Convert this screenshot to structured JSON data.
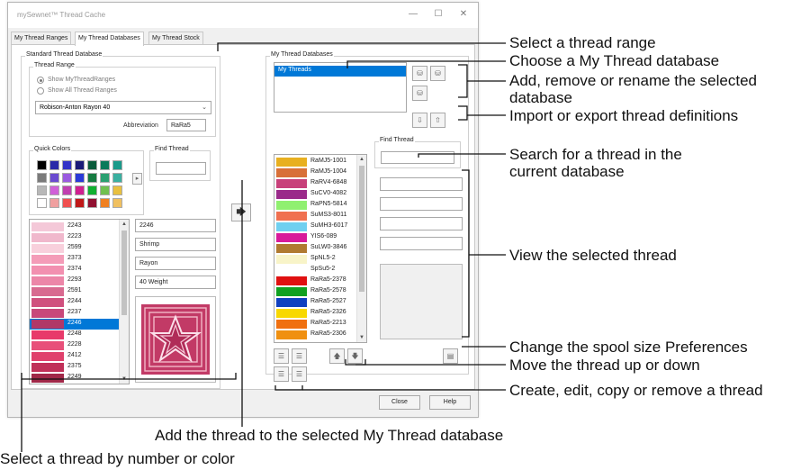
{
  "window": {
    "title": "mySewnet™ Thread Cache",
    "tabs": [
      "My Thread Ranges",
      "My Thread Databases",
      "My Thread Stock"
    ],
    "active_tab": 1
  },
  "standard_db": {
    "group_label": "Standard Thread Database",
    "thread_range_label": "Thread Range",
    "radio_show_my": "Show MyThreadRanges",
    "radio_show_all": "Show All Thread Ranges",
    "range_selected": "Robison-Anton Rayon 40",
    "abbreviation_label": "Abbreviation",
    "abbreviation_value": "RaRa5",
    "quick_colors_label": "Quick Colors",
    "find_thread_label": "Find Thread",
    "find_thread_value": "",
    "quick_colors": [
      [
        "#000000",
        "#2a2aa8",
        "#3434c8",
        "#1a1a78",
        "#0a5a3a",
        "#0a7a5a",
        "#1a9a8a"
      ],
      [
        "#7a7a7a",
        "#6a4ad0",
        "#9a5ae0",
        "#2a3ad8",
        "#157a40",
        "#2aa070",
        "#3ab0a0"
      ],
      [
        "#b8b8b8",
        "#d060d8",
        "#c040b0",
        "#d02090",
        "#10b030",
        "#70c050",
        "#e8c040"
      ],
      [
        "#ffffff",
        "#f0a0a0",
        "#f05050",
        "#c01818",
        "#901030",
        "#f08020",
        "#f0c060"
      ]
    ],
    "threads": [
      {
        "num": "2243",
        "color": "#f4c8d8"
      },
      {
        "num": "2223",
        "color": "#f0b8cc"
      },
      {
        "num": "2599",
        "color": "#f8d0dc"
      },
      {
        "num": "2373",
        "color": "#f49cb8"
      },
      {
        "num": "2374",
        "color": "#f290b0"
      },
      {
        "num": "2293",
        "color": "#ec86a8"
      },
      {
        "num": "2591",
        "color": "#d86a90"
      },
      {
        "num": "2244",
        "color": "#d0507e"
      },
      {
        "num": "2237",
        "color": "#c8487a"
      },
      {
        "num": "2246",
        "color": "#b03868"
      },
      {
        "num": "2248",
        "color": "#e83a6a"
      },
      {
        "num": "2228",
        "color": "#e8507a"
      },
      {
        "num": "2412",
        "color": "#e0406c"
      },
      {
        "num": "2375",
        "color": "#c03058"
      },
      {
        "num": "2249",
        "color": "#a02848"
      }
    ],
    "selected_index": 9,
    "detail": {
      "number": "2246",
      "name": "Shrimp",
      "type": "Rayon",
      "weight": "40 Weight"
    }
  },
  "my_db": {
    "group_label": "My Thread Databases",
    "databases": [
      "My Threads"
    ],
    "find_thread_label": "Find Thread",
    "find_thread_value": "",
    "threads": [
      {
        "code": "RaMJ5-1001",
        "color": "#e8b020"
      },
      {
        "code": "RaMJ5-1004",
        "color": "#d87038"
      },
      {
        "code": "RaRV4-6848",
        "color": "#c8407a"
      },
      {
        "code": "SuCV0-4082",
        "color": "#9a2a8a"
      },
      {
        "code": "RaPN5-5814",
        "color": "#90f070"
      },
      {
        "code": "SuMS3-8011",
        "color": "#f07050"
      },
      {
        "code": "SuMH3-6017",
        "color": "#70d0f0"
      },
      {
        "code": "YIS6-089",
        "color": "#d81a9a"
      },
      {
        "code": "SuLW0-3846",
        "color": "#b07a30"
      },
      {
        "code": "SpNL5-2",
        "color": "#f8f4c8"
      },
      {
        "code": "SpSu5-2",
        "color": "#ffffff"
      },
      {
        "code": "RaRa5-2378",
        "color": "#e01010"
      },
      {
        "code": "RaRa5-2578",
        "color": "#10a020"
      },
      {
        "code": "RaRa5-2527",
        "color": "#1040c0"
      },
      {
        "code": "RaRa5-2326",
        "color": "#f8d800"
      },
      {
        "code": "RaRa5-2213",
        "color": "#f07010"
      },
      {
        "code": "RaRa5-2306",
        "color": "#f09010"
      }
    ]
  },
  "buttons": {
    "close": "Close",
    "help": "Help"
  },
  "callouts": {
    "select_range": "Select a thread range",
    "choose_db": "Choose a My Thread database",
    "add_remove": "Add, remove or rename the selected",
    "add_remove_2": "database",
    "import_export": "Import or export thread definitions",
    "search_1": "Search for a thread in the",
    "search_2": "current database",
    "view": "View the selected thread",
    "spool": "Change the spool size Preferences",
    "move": "Move the thread up or down",
    "create": "Create, edit, copy or remove a thread",
    "add_thread": "Add the thread to the selected My Thread database",
    "select_thread": "Select a thread by number or color"
  }
}
